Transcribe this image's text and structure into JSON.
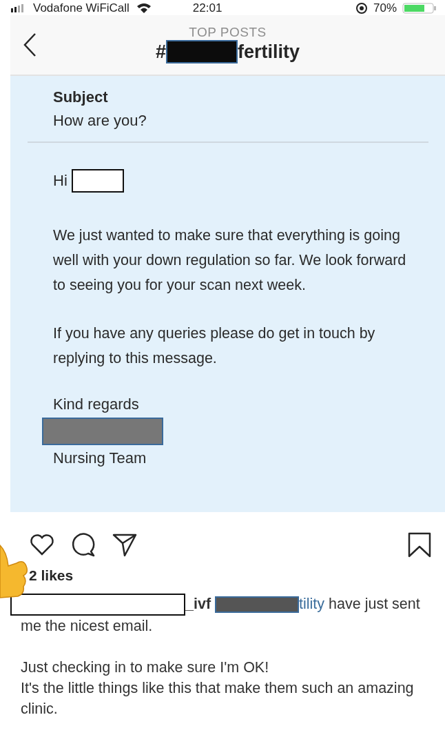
{
  "status_bar": {
    "carrier": "Vodafone WiFiCall",
    "time": "22:01",
    "battery": "70%"
  },
  "header": {
    "title": "TOP POSTS",
    "hashtag_prefix": "#",
    "hashtag_suffix": "fertility"
  },
  "post": {
    "subject_label": "Subject",
    "subject": "How are you?",
    "greeting": "Hi",
    "paragraphs": [
      "We just wanted to make sure that everything is going well with your down regulation so far. We look forward to seeing you for your scan next week.",
      "If you have any queries please do get in touch by replying to this message."
    ],
    "sign_off": "Kind regards",
    "team": "Nursing Team"
  },
  "likes": "2 likes",
  "caption": {
    "username_suffix": "_ivf",
    "mention_suffix": "tility",
    "text": " have just sent me the nicest email.",
    "body": "Just checking in to make sure I'm OK!\nIt's the little things like this that make them such an amazing clinic."
  }
}
